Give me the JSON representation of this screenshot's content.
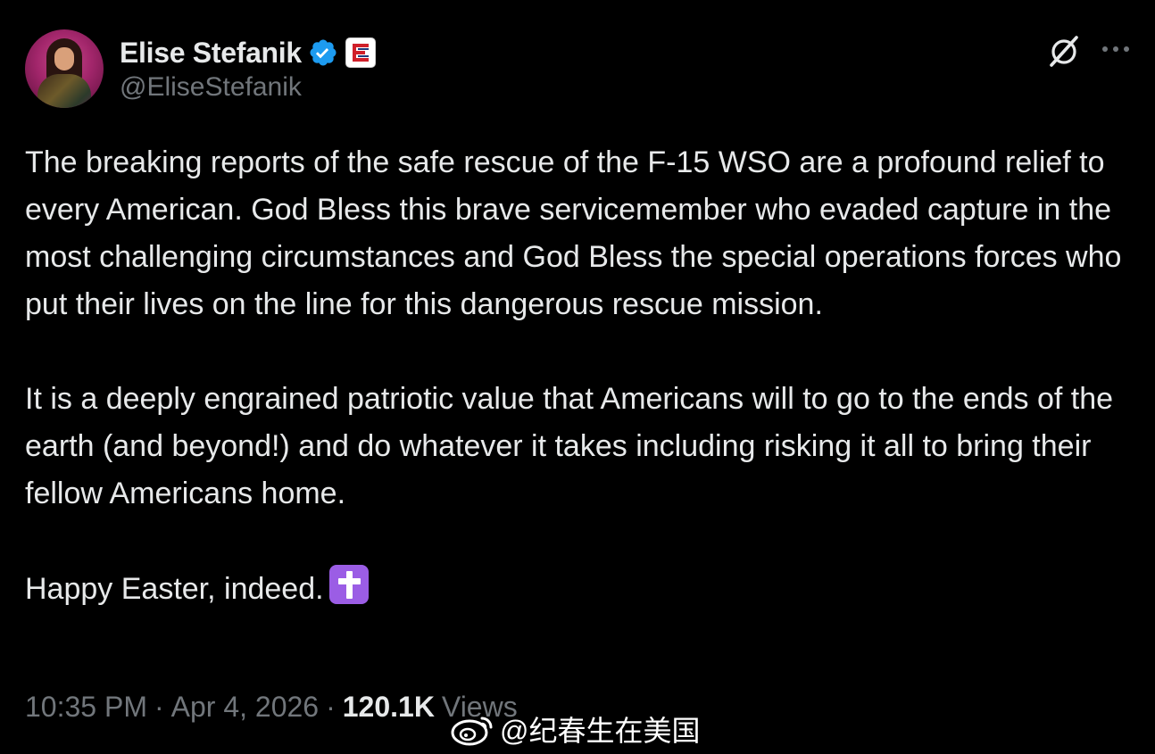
{
  "author": {
    "display_name": "Elise Stefanik",
    "handle": "@EliseStefanik"
  },
  "icons": {
    "verified": "verified-badge-icon",
    "affiliate": "affiliate-logo-icon",
    "grok": "grok-icon",
    "more": "more-options-icon",
    "emoji": "latin-cross-emoji-icon",
    "watermark": "weibo-logo-icon"
  },
  "colors": {
    "background": "#000000",
    "text": "#e7e9ea",
    "muted": "#71767b",
    "verified": "#1d9bf0",
    "emoji_bg": "#9b5de5"
  },
  "tweet": {
    "paragraphs": [
      "The breaking reports of the safe rescue of the F-15 WSO are a profound relief to every American. God Bless this brave servicemember who evaded capture in the most challenging circumstances and God Bless the special operations forces who put their lives on the line for this dangerous rescue mission.",
      "It is a deeply engrained patriotic value that Americans will to go to the ends of the earth (and beyond!) and do whatever it takes including risking it all to bring their fellow Americans home.",
      "Happy Easter, indeed."
    ]
  },
  "meta": {
    "time": "10:35 PM",
    "separator": "·",
    "date": "Apr 4, 2026",
    "views_count": "120.1K",
    "views_label": "Views"
  },
  "watermark": {
    "text": "@纪春生在美国"
  }
}
